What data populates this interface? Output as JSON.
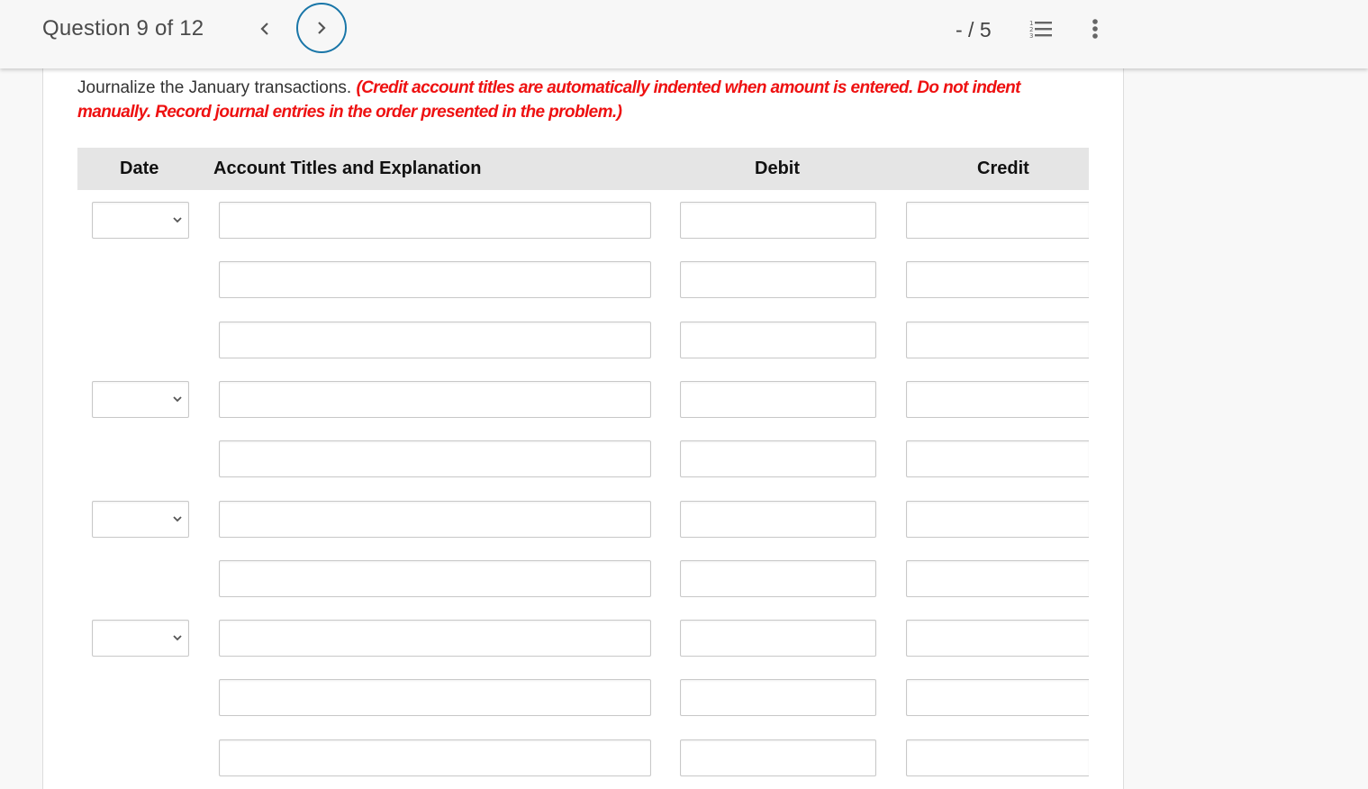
{
  "header": {
    "question_label": "Question 9 of 12",
    "prev_icon": "chevron-left-icon",
    "next_icon": "chevron-right-icon",
    "score": "- / 5",
    "list_icon": "numbered-list-icon",
    "more_icon": "more-vertical-icon",
    "accent_color": "#1976a8"
  },
  "question": {
    "instruction": "Journalize the January transactions. ",
    "note": "(Credit account titles are automatically indented when amount is entered. Do not indent manually. Record journal entries in the order presented in the problem.)",
    "note_color": "#ee1111"
  },
  "table": {
    "columns": [
      "Date",
      "Account Titles and Explanation",
      "Debit",
      "Credit"
    ],
    "rows": [
      {
        "has_date": true,
        "date": "",
        "account": "",
        "debit": "",
        "credit": ""
      },
      {
        "has_date": false,
        "account": "",
        "debit": "",
        "credit": ""
      },
      {
        "has_date": false,
        "account": "",
        "debit": "",
        "credit": ""
      },
      {
        "has_date": true,
        "date": "",
        "account": "",
        "debit": "",
        "credit": ""
      },
      {
        "has_date": false,
        "account": "",
        "debit": "",
        "credit": ""
      },
      {
        "has_date": true,
        "date": "",
        "account": "",
        "debit": "",
        "credit": ""
      },
      {
        "has_date": false,
        "account": "",
        "debit": "",
        "credit": ""
      },
      {
        "has_date": true,
        "date": "",
        "account": "",
        "debit": "",
        "credit": ""
      },
      {
        "has_date": false,
        "account": "",
        "debit": "",
        "credit": ""
      },
      {
        "has_date": false,
        "account": "",
        "debit": "",
        "credit": ""
      }
    ]
  }
}
